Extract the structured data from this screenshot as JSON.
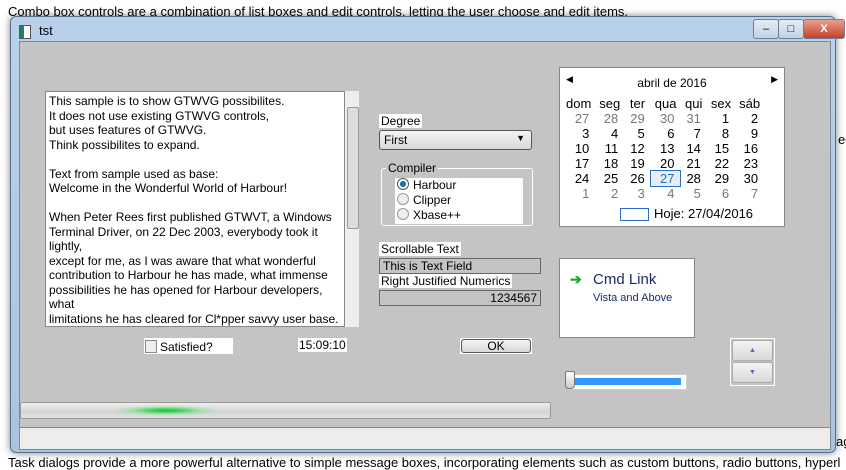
{
  "background": {
    "top_text": "Combo box controls are a combination of list boxes and edit controls, letting the user choose and edit items.",
    "bottom_text": "Task dialogs provide a more powerful alternative to simple message boxes, incorporating elements such as custom buttons, radio buttons, hyperl",
    "right_fragment_1": "ed",
    "right_fragment_2": "ag"
  },
  "window": {
    "title": "tst",
    "minimize": "–",
    "maximize": "□",
    "close": "X"
  },
  "memo": {
    "text": "This sample is to show GTWVG possibilites.\nIt does not use existing GTWVG controls,\nbut uses features of GTWVG.\nThink possibilites to expand.\n\nText from sample used as base:\nWelcome in the Wonderful World of Harbour!\n\nWhen Peter Rees first published GTWVT, a Windows\nTerminal Driver, on 22 Dec 2003, everybody took it lightly,\nexcept for me, as I was aware that what wonderful\ncontribution to Harbour he has made, what immense\npossibilities he has opened for Harbour developers, what\nlimitations he has cleared for Cl*pper savvy user base.\n\nWith a little effort I could extend GTWVT to give it a GUI look.\nI also tried to give it an event driven functionality, and up\ncame Wvt*Classes."
  },
  "degree": {
    "label": "Degree",
    "value": "First"
  },
  "compiler": {
    "label": "Compiler",
    "options": [
      "Harbour",
      "Clipper",
      "Xbase++"
    ],
    "selected": "Harbour"
  },
  "scrollable": {
    "label": "Scrollable Text",
    "value": "This is Text Field"
  },
  "numeric": {
    "label": "Right Justified Numerics",
    "value": "1234567"
  },
  "calendar": {
    "month": "abril de 2016",
    "days": [
      "dom",
      "seg",
      "ter",
      "qua",
      "qui",
      "sex",
      "sáb"
    ],
    "weeks": [
      [
        "27",
        "28",
        "29",
        "30",
        "31",
        "1",
        "2"
      ],
      [
        "3",
        "4",
        "5",
        "6",
        "7",
        "8",
        "9"
      ],
      [
        "10",
        "11",
        "12",
        "13",
        "14",
        "15",
        "16"
      ],
      [
        "17",
        "18",
        "19",
        "20",
        "21",
        "22",
        "23"
      ],
      [
        "24",
        "25",
        "26",
        "27",
        "28",
        "29",
        "30"
      ],
      [
        "1",
        "2",
        "3",
        "4",
        "5",
        "6",
        "7"
      ]
    ],
    "selected": "27",
    "today": "Hoje: 27/04/2016"
  },
  "cmdlink": {
    "title": "Cmd Link",
    "subtitle": "Vista and Above"
  },
  "checkbox": {
    "label": "Satisfied?",
    "checked": false
  },
  "clock": "15:09:10",
  "ok": "OK",
  "slider": {
    "value": 0
  },
  "colors": {
    "client": "#c4c4c4",
    "slider_fill": "#3399ff",
    "progress_glow": "#22cc44"
  }
}
